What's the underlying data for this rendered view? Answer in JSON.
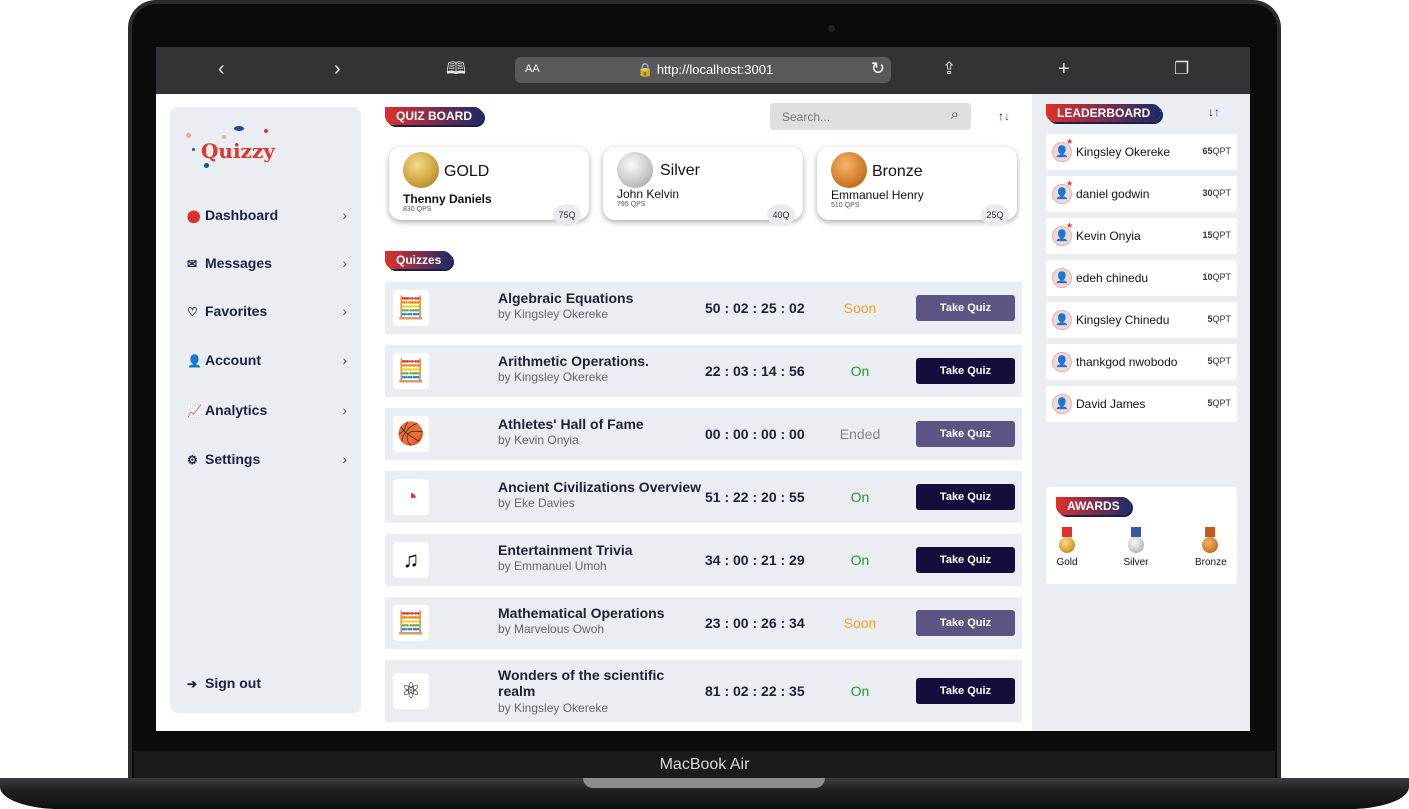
{
  "device": {
    "label": "MacBook Air"
  },
  "browser": {
    "back_icon": "chevron-left-icon",
    "forward_icon": "chevron-right-icon",
    "text_size": "AA",
    "url": "http://localhost:3001"
  },
  "sidebar": {
    "logo": "Quizzy",
    "items": [
      {
        "label": "Dashboard",
        "icon": "palette-icon"
      },
      {
        "label": "Messages",
        "icon": "envelope-icon"
      },
      {
        "label": "Favorites",
        "icon": "heart-icon"
      },
      {
        "label": "Account",
        "icon": "user-icon"
      },
      {
        "label": "Analytics",
        "icon": "line-chart-icon"
      },
      {
        "label": "Settings",
        "icon": "gear-icon"
      }
    ],
    "sign_out": "Sign out"
  },
  "quiz_board": {
    "title": "QUIZ BOARD",
    "search_placeholder": "Search...",
    "podium": [
      {
        "rank": "GOLD",
        "name": "Thenny Daniels",
        "qps": "830 QPS",
        "quizzes": "75Q",
        "color": "#c9a13c"
      },
      {
        "rank": "Silver",
        "name": "John Kelvin",
        "qps": "795 QPS",
        "quizzes": "40Q",
        "color": "#c4c6c9"
      },
      {
        "rank": "Bronze",
        "name": "Emmanuel Henry",
        "qps": "510 QPS",
        "quizzes": "25Q",
        "color": "#d17c2b"
      }
    ]
  },
  "quizzes": {
    "title": "Quizzes",
    "button_label": "Take Quiz",
    "items": [
      {
        "title": "Algebraic Equations",
        "author": "by Kingsley Okereke",
        "time": "50 : 02 : 25 : 02",
        "status": "Soon",
        "icon": "calculator-icon"
      },
      {
        "title": "Arithmetic Operations.",
        "author": "by Kingsley Okereke",
        "time": "22 : 03 : 14 : 56",
        "status": "On",
        "icon": "calculator-icon"
      },
      {
        "title": "Athletes' Hall of Fame",
        "author": "by Kevin Onyia",
        "time": "00 : 00 : 00 : 00",
        "status": "Ended",
        "icon": "sports-balls-icon"
      },
      {
        "title": "Ancient Civilizations Overview",
        "author": "by Eke Davies",
        "time": "51 : 22 : 20 : 55",
        "status": "On",
        "icon": "compass-icon"
      },
      {
        "title": "Entertainment Trivia",
        "author": "by Emmanuel Umoh",
        "time": "34 : 00 : 21 : 29",
        "status": "On",
        "icon": "music-chat-icon"
      },
      {
        "title": "Mathematical Operations",
        "author": "by Marvelous Owoh",
        "time": "23 : 00 : 26 : 34",
        "status": "Soon",
        "icon": "calculator-icon"
      },
      {
        "title": "Wonders of the scientific realm",
        "author": "by Kingsley Okereke",
        "time": "81 : 02 : 22 : 35",
        "status": "On",
        "icon": "atom-icon"
      }
    ]
  },
  "leaderboard": {
    "title": "LEADERBOARD",
    "unit": "QPT",
    "entries": [
      {
        "name": "Kingsley Okereke",
        "points": "65"
      },
      {
        "name": "daniel godwin",
        "points": "30"
      },
      {
        "name": "Kevin Onyia",
        "points": "15"
      },
      {
        "name": "edeh chinedu",
        "points": "10"
      },
      {
        "name": "Kingsley Chinedu",
        "points": "5"
      },
      {
        "name": "thankgod nwobodo",
        "points": "5"
      },
      {
        "name": "David James",
        "points": "5"
      }
    ]
  },
  "awards": {
    "title": "AWARDS",
    "items": [
      {
        "label": "Gold",
        "color": "#d9a030",
        "ribbon": "#e0302b"
      },
      {
        "label": "Silver",
        "color": "#c4c6c9",
        "ribbon": "#3a56a8"
      },
      {
        "label": "Bronze",
        "color": "#d17c2b",
        "ribbon": "#c25a1c"
      }
    ]
  },
  "colors": {
    "soon": "#f0a020",
    "on": "#1f9a2f",
    "ended": "#888888",
    "btn_dark": "#130f3d",
    "btn_muted": "#5c5483"
  }
}
